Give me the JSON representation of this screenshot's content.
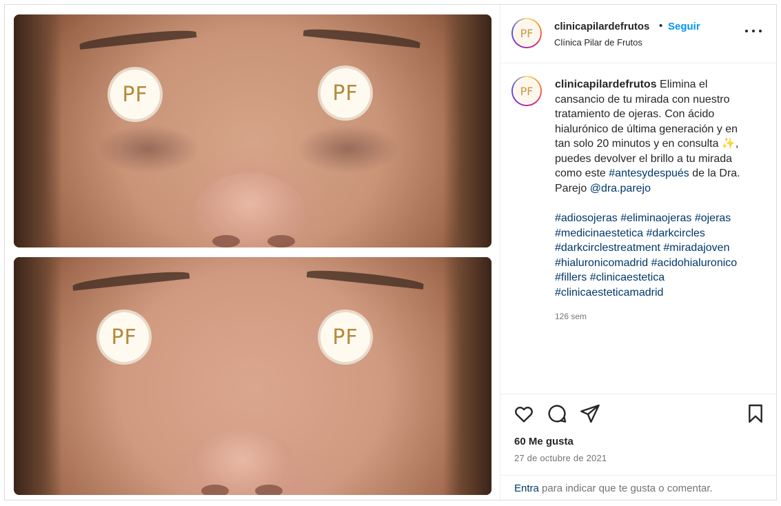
{
  "header": {
    "username": "clinicapilardefrutos",
    "separator": "•",
    "follow_label": "Seguir",
    "full_name": "Clínica Pilar de Frutos",
    "avatar_text": "PF"
  },
  "media": {
    "logo_text": "PF"
  },
  "caption": {
    "username": "clinicapilardefrutos",
    "text_1": " Elimina el cansancio de tu mirada con nuestro tratamiento de ojeras. Con ácido hialurónico de última generación y en tan solo 20 minutos y en consulta ",
    "emoji": "✨",
    "text_2": ", puedes devolver el brillo a tu mirada como este ",
    "hashtag_inline": "#antesydespués",
    "text_3": " de la Dra. Parejo ",
    "mention": "@dra.parejo",
    "hashtags": [
      "#adiosojeras",
      "#eliminaojeras",
      "#ojeras",
      "#medicinaestetica",
      "#darkcircles",
      "#darkcirclestreatment",
      "#miradajoven",
      "#hialuronicomadrid",
      "#acidohialuronico",
      "#fillers",
      "#clinicaestetica",
      "#clinicaesteticamadrid"
    ],
    "time": "126 sem"
  },
  "actions": {
    "like_icon": "heart-icon",
    "comment_icon": "comment-icon",
    "share_icon": "share-icon",
    "save_icon": "bookmark-icon"
  },
  "likes_label": "60 Me gusta",
  "date_label": "27 de octubre de 2021",
  "comment": {
    "enter_label": "Entra",
    "rest_label": " para indicar que te gusta o comentar."
  }
}
